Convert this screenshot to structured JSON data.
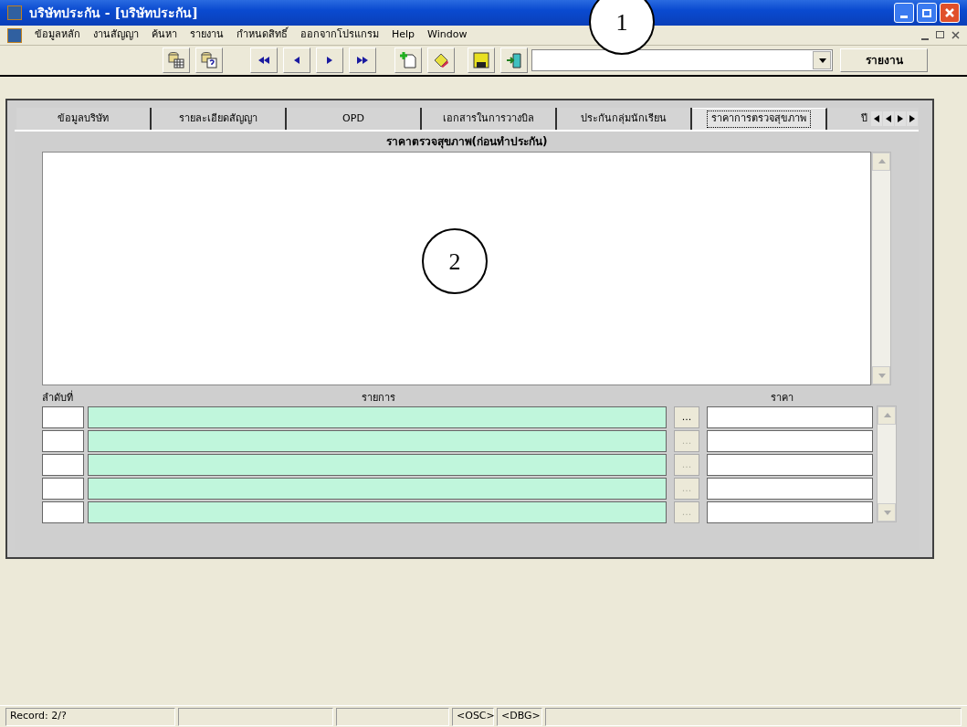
{
  "window": {
    "title": "บริษัทประกัน - [บริษัทประกัน]"
  },
  "menu": [
    "ข้อมูลหลัก",
    "งานสัญญา",
    "ค้นหา",
    "รายงาน",
    "กำหนดสิทธิ์",
    "ออกจากโปรแกรม",
    "Help",
    "Window"
  ],
  "toolbar": {
    "report_button": "รายงาน"
  },
  "tabs": [
    {
      "label": "ข้อมูลบริษัท",
      "selected": false
    },
    {
      "label": "รายละเอียดสัญญา",
      "selected": false
    },
    {
      "label": "OPD",
      "selected": false
    },
    {
      "label": "เอกสารในการวางบิล",
      "selected": false
    },
    {
      "label": "ประกันกลุ่มนักเรียน",
      "selected": false
    },
    {
      "label": "ราคาการตรวจสุขภาพ",
      "selected": true
    },
    {
      "label": "ปี",
      "selected": false
    }
  ],
  "section_title": "ราคาตรวจสุขภาพ(ก่อนทำประกัน)",
  "grid": {
    "columns": [
      "ลำดับที่",
      "รายการ",
      "ราคา"
    ],
    "rows": [
      {
        "lookup": "...",
        "disabled": false
      },
      {
        "lookup": "...",
        "disabled": true
      },
      {
        "lookup": "...",
        "disabled": true
      },
      {
        "lookup": "...",
        "disabled": true
      },
      {
        "lookup": "...",
        "disabled": true
      }
    ]
  },
  "status_bar": [
    "Record: 2/?",
    "<OSC>",
    "<DBG>"
  ],
  "callouts": [
    {
      "label": "1"
    },
    {
      "label": "2"
    }
  ]
}
